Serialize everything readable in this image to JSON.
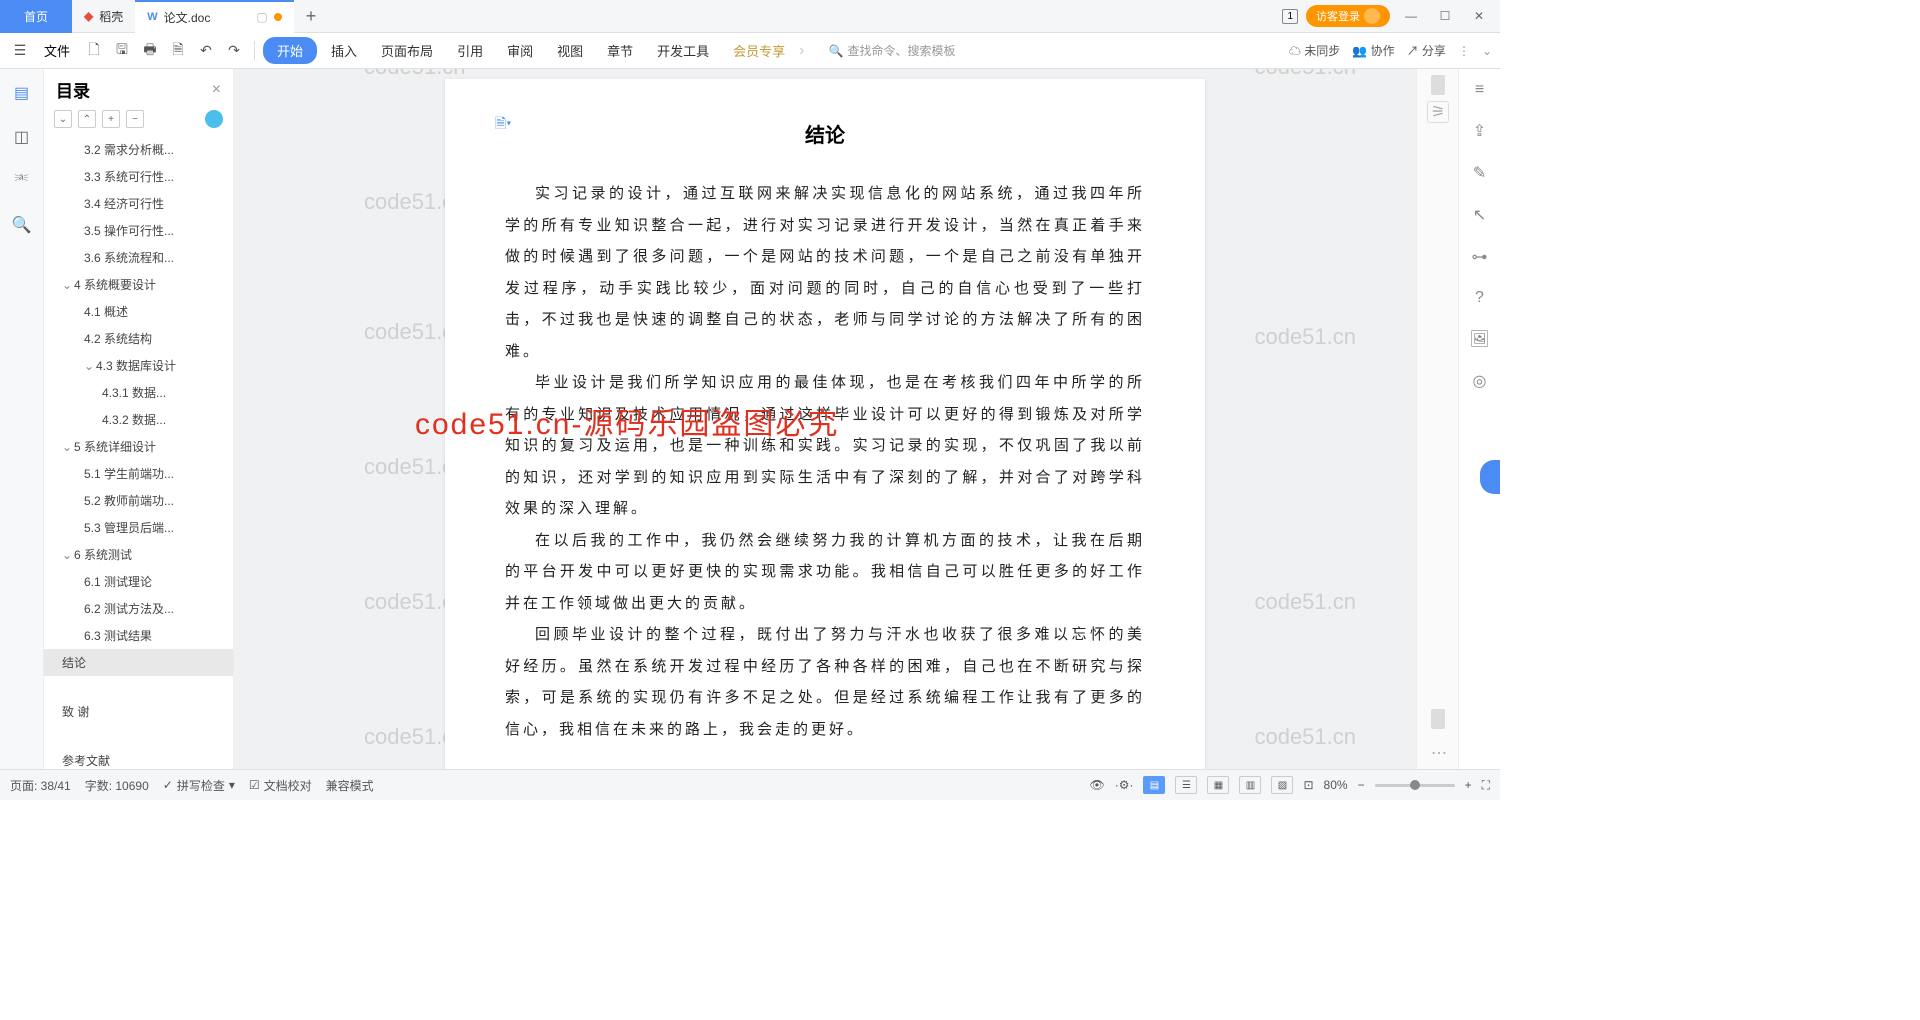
{
  "tabs": {
    "home": "首页",
    "docker": "稻壳",
    "doc": "论文.doc",
    "login": "访客登录"
  },
  "ribbon": {
    "file": "文件",
    "items": [
      "开始",
      "插入",
      "页面布局",
      "引用",
      "审阅",
      "视图",
      "章节",
      "开发工具",
      "会员专享"
    ],
    "search": "查找命令、搜索模板",
    "sync": "未同步",
    "coop": "协作",
    "share": "分享"
  },
  "toc": {
    "title": "目录",
    "items": [
      {
        "t": "3.2 需求分析概...",
        "lv": 2
      },
      {
        "t": "3.3 系统可行性...",
        "lv": 2
      },
      {
        "t": "3.4 经济可行性",
        "lv": 2
      },
      {
        "t": "3.5 操作可行性...",
        "lv": 2
      },
      {
        "t": "3.6 系统流程和...",
        "lv": 2
      },
      {
        "t": "4 系统概要设计",
        "lv": 1,
        "c": true
      },
      {
        "t": "4.1 概述",
        "lv": 2
      },
      {
        "t": "4.2 系统结构",
        "lv": 2
      },
      {
        "t": "4.3 数据库设计",
        "lv": 2,
        "c": true
      },
      {
        "t": "4.3.1 数据...",
        "lv": 3
      },
      {
        "t": "4.3.2 数据...",
        "lv": 3
      },
      {
        "t": "5 系统详细设计",
        "lv": 1,
        "c": true
      },
      {
        "t": "5.1 学生前端功...",
        "lv": 2
      },
      {
        "t": "5.2 教师前端功...",
        "lv": 2
      },
      {
        "t": "5.3 管理员后端...",
        "lv": 2
      },
      {
        "t": "6  系统测试",
        "lv": 1,
        "c": true
      },
      {
        "t": "6.1 测试理论",
        "lv": 2
      },
      {
        "t": "6.2 测试方法及...",
        "lv": 2
      },
      {
        "t": "6.3 测试结果",
        "lv": 2
      },
      {
        "t": "结论",
        "lv": 1,
        "sel": true
      },
      {
        "t": "致  谢",
        "lv": 1,
        "sp": true
      },
      {
        "t": "参考文献",
        "lv": 1,
        "sp": true
      }
    ]
  },
  "document": {
    "heading": "结论",
    "p1": "实习记录的设计，通过互联网来解决实现信息化的网站系统，通过我四年所学的所有专业知识整合一起，进行对实习记录进行开发设计，当然在真正着手来做的时候遇到了很多问题，一个是网站的技术问题，一个是自己之前没有单独开发过程序，动手实践比较少，面对问题的同时，自己的自信心也受到了一些打击，不过我也是快速的调整自己的状态，老师与同学讨论的方法解决了所有的困难。",
    "p2": "毕业设计是我们所学知识应用的最佳体现，也是在考核我们四年中所学的所有的专业知识及技术应用情况，通过这样毕业设计可以更好的得到锻炼及对所学知识的复习及运用，也是一种训练和实践。实习记录的实现，不仅巩固了我以前的知识，还对学到的知识应用到实际生活中有了深刻的了解，并对合了对跨学科效果的深入理解。",
    "p3": "在以后我的工作中，我仍然会继续努力我的计算机方面的技术，让我在后期的平台开发中可以更好更快的实现需求功能。我相信自己可以胜任更多的好工作并在工作领域做出更大的贡献。",
    "p4": "回顾毕业设计的整个过程，既付出了努力与汗水也收获了很多难以忘怀的美好经历。虽然在系统开发过程中经历了各种各样的困难，自己也在不断研究与探索，可是系统的实现仍有许多不足之处。但是经过系统编程工作让我有了更多的信心，我相信在未来的路上，我会走的更好。"
  },
  "watermarks": {
    "text": "code51.cn",
    "red": "code51.cn-源码乐园盗图必究"
  },
  "status": {
    "page": "页面: 38/41",
    "words": "字数: 10690",
    "spell": "拼写检查",
    "proof": "文档校对",
    "compat": "兼容模式",
    "zoom": "80%"
  }
}
